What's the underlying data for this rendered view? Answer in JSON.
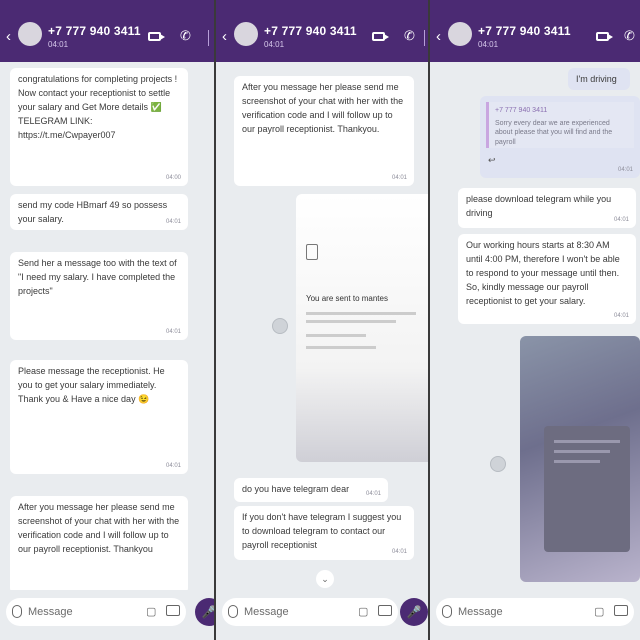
{
  "accent": "#4b2a73",
  "header": {
    "phone": "+7 777 940 3411",
    "status": "04:01",
    "back_icon": "back-arrow-icon",
    "video_icon": "video-call-icon",
    "call_icon": "phone-call-icon"
  },
  "composer": {
    "placeholder": "Message",
    "attach_icon": "paperclip-icon",
    "sticker_icon": "sticker-icon",
    "camera_icon": "camera-icon",
    "mic_icon": "microphone-icon"
  },
  "panel1": {
    "messages": [
      {
        "text": "congratulations for completing projects ! Now contact your receptionist to settle your salary and Get More details ✅ TELEGRAM LINK: https://t.me/Cwpayer007",
        "time": "04:00"
      },
      {
        "text": "send my code HBmarf 49 so possess your salary.",
        "time": "04:01"
      },
      {
        "text": "Send her a message too with the text of \"I need my salary. I have completed the projects\"",
        "time": "04:01"
      },
      {
        "text": "Please message the receptionist. He you to get your salary immediately. Thank you & Have a nice day 😉",
        "time": "04:01"
      },
      {
        "text": "After you message her please send me screenshot of your chat with her with the verification code and I will follow up to our payroll receptionist. Thankyou",
        "time": ""
      }
    ]
  },
  "panel2": {
    "messages": [
      {
        "text": "After you message her please send me screenshot of your chat with her with the verification code and I will follow up to our payroll receptionist. Thankyou.",
        "time": "04:01"
      },
      {
        "text": "do you have telegram dear",
        "time": "04:01"
      },
      {
        "text": "If you don't have telegram I suggest you to download telegram to contact our payroll receptionist",
        "time": "04:01"
      }
    ],
    "doc_title": "You are sent to mantes"
  },
  "panel3": {
    "messages": [
      {
        "text": "I'm driving",
        "time": ""
      },
      {
        "text": "please download telegram while you driving",
        "time": "04:01"
      },
      {
        "text": "Our working hours starts at 8:30 AM until 4:00 PM, therefore I won't be able to respond to your message until then. So, kindly message our payroll receptionist to get your salary.",
        "time": "04:01"
      }
    ],
    "quoted": {
      "name": "+7 777 940 3411",
      "text": "Sorry every dear we are experienced about please that you will find and the payroll",
      "time": "04:01"
    }
  }
}
